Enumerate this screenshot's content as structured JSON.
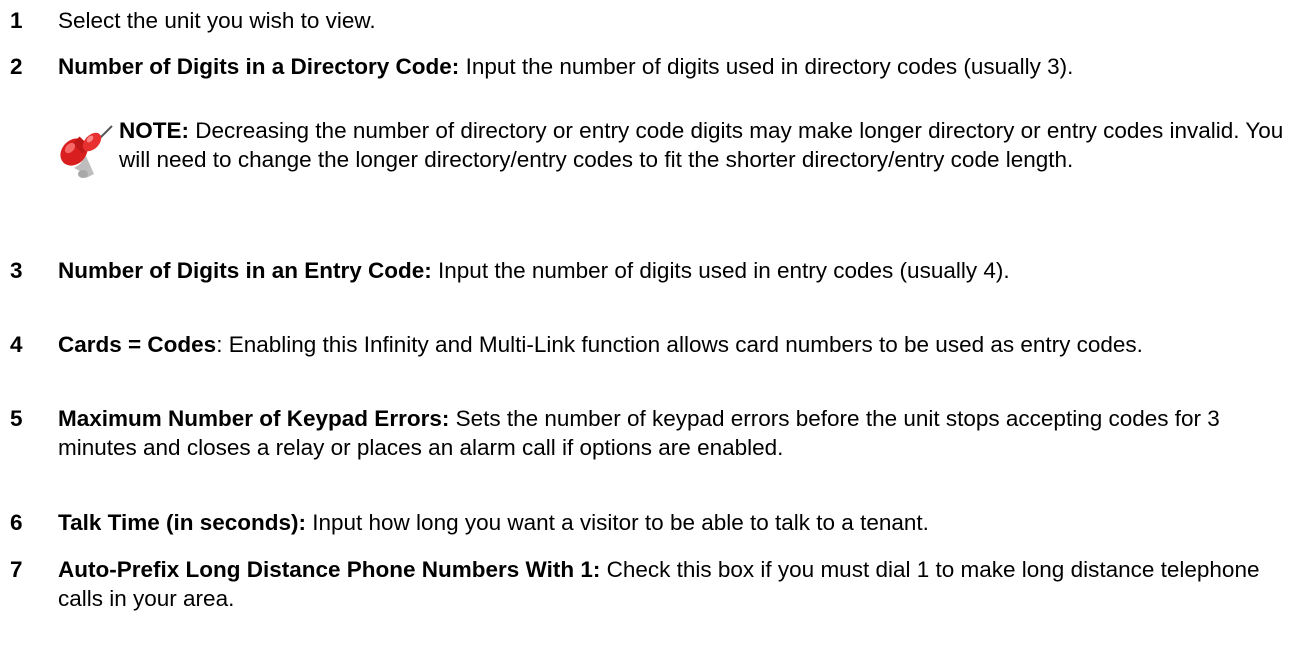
{
  "items": [
    {
      "number": "1",
      "term": "",
      "text": "Select the unit you wish to view."
    },
    {
      "number": "2",
      "term": "Number of Digits in a Directory Code:",
      "text": " Input the number of digits used in directory codes (usually 3)."
    },
    {
      "number": "3",
      "term": "Number of Digits in an Entry Code:",
      "text": " Input the number of digits used in entry codes (usually 4)."
    },
    {
      "number": "4",
      "term": "Cards = Codes",
      "text": ": Enabling this Infinity and Multi-Link function allows card numbers to be used as entry codes."
    },
    {
      "number": "5",
      "term": "Maximum Number of Keypad Errors:",
      "text": " Sets the number of keypad errors before the unit stops accepting codes for 3 minutes and closes a relay or places an alarm call if options are enabled."
    },
    {
      "number": "6",
      "term": "Talk Time (in seconds):",
      "text": " Input how long you want a visitor to be able to talk to a tenant."
    },
    {
      "number": "7",
      "term": "Auto-Prefix Long Distance Phone Numbers With 1:",
      "text": " Check this box if you must dial 1 to make long distance telephone calls in your area."
    }
  ],
  "note": {
    "label": "NOTE:",
    "text": " Decreasing the number of directory or entry code digits may make longer directory or entry codes invalid.  You will need to change the longer directory/entry codes to fit the shorter directory/entry code length.",
    "icon": "pushpin-icon",
    "icon_color": "#e02020"
  }
}
